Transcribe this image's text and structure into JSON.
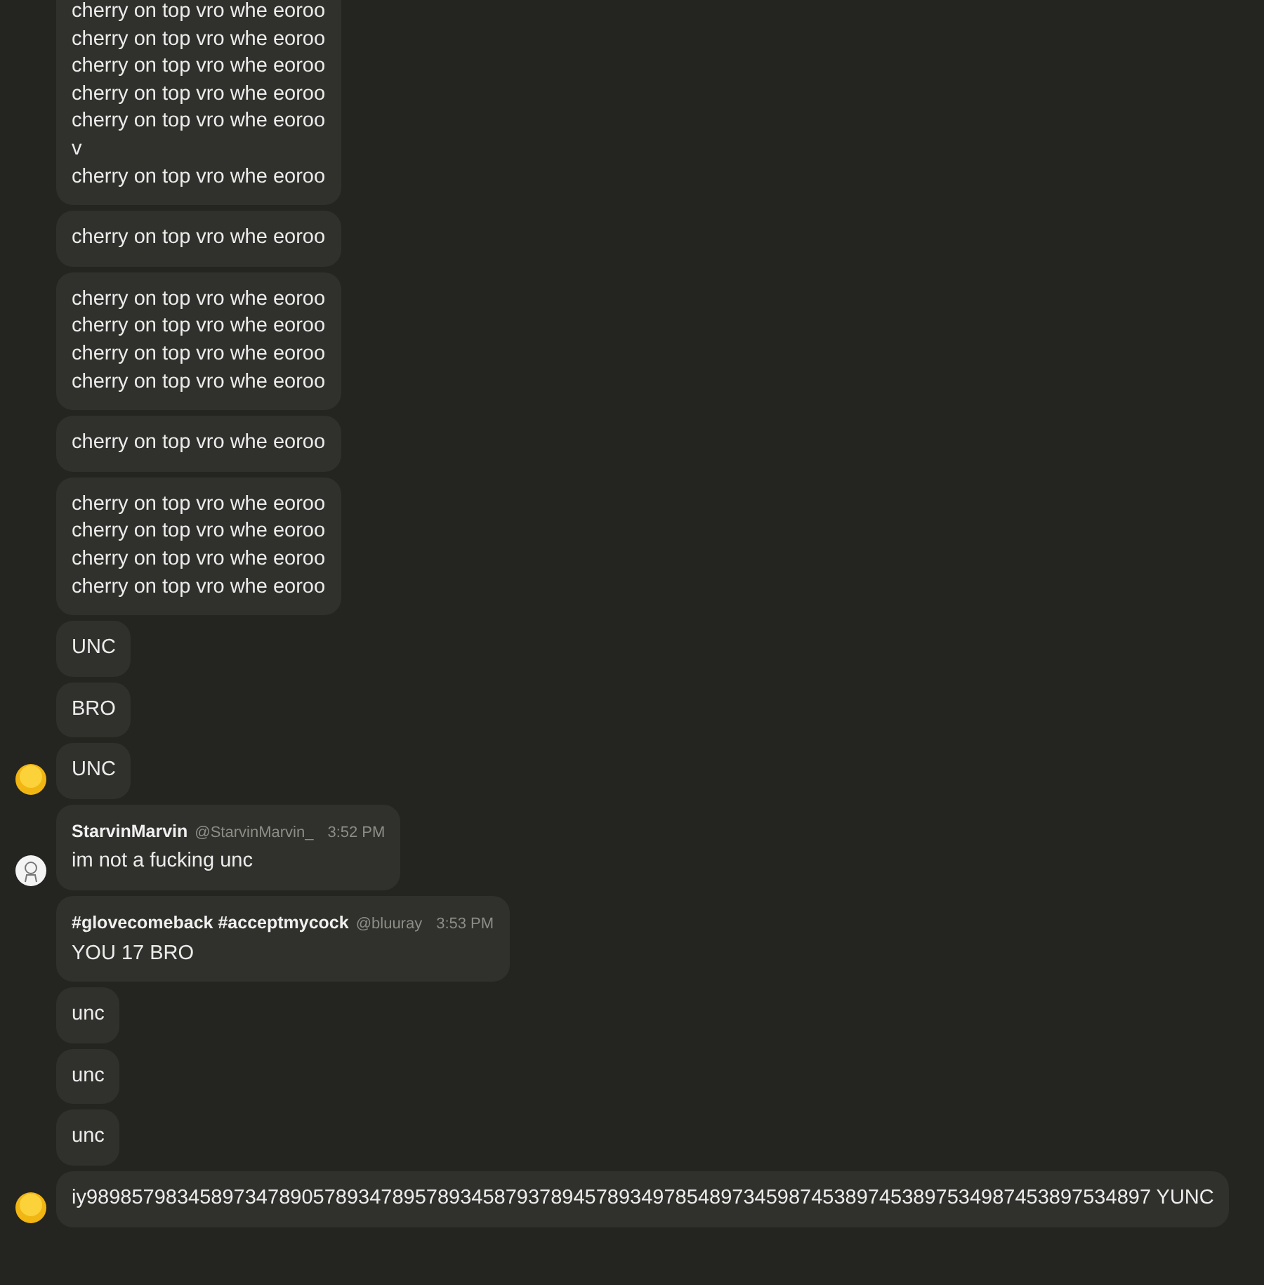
{
  "groups": [
    {
      "avatar": {
        "kind": "emoji"
      },
      "messages": [
        "cherry on top vro whe eoroo\ncherry on top vro whe eoroo\ncherry on top vro whe eoroo\ncherry on top vro whe eoroo\ncherry on top vro whe eoroo\nv\ncherry on top vro whe eoroo",
        "cherry on top vro whe eoroo",
        "cherry on top vro whe eoroo\ncherry on top vro whe eoroo\ncherry on top vro whe eoroo\ncherry on top vro whe eoroo",
        "cherry on top vro whe eoroo",
        "cherry on top vro whe eoroo\ncherry on top vro whe eoroo\ncherry on top vro whe eoroo\ncherry on top vro whe eoroo",
        "UNC",
        "BRO",
        "UNC"
      ]
    },
    {
      "avatar": {
        "kind": "sketch"
      },
      "header": {
        "name": "StarvinMarvin",
        "handle": "@StarvinMarvin_",
        "time": "3:52 PM"
      },
      "messages": [
        "im not a fucking unc"
      ]
    },
    {
      "avatar": {
        "kind": "emoji"
      },
      "header": {
        "name": "#glovecomeback #acceptmycock",
        "handle": "@bluuray",
        "time": "3:53 PM"
      },
      "messages": [
        "YOU 17 BRO",
        "unc",
        "unc",
        "unc",
        "iy9898579834589734789057893478957893458793789457893497854897345987453897453897534987453897534897 YUNC"
      ]
    }
  ]
}
